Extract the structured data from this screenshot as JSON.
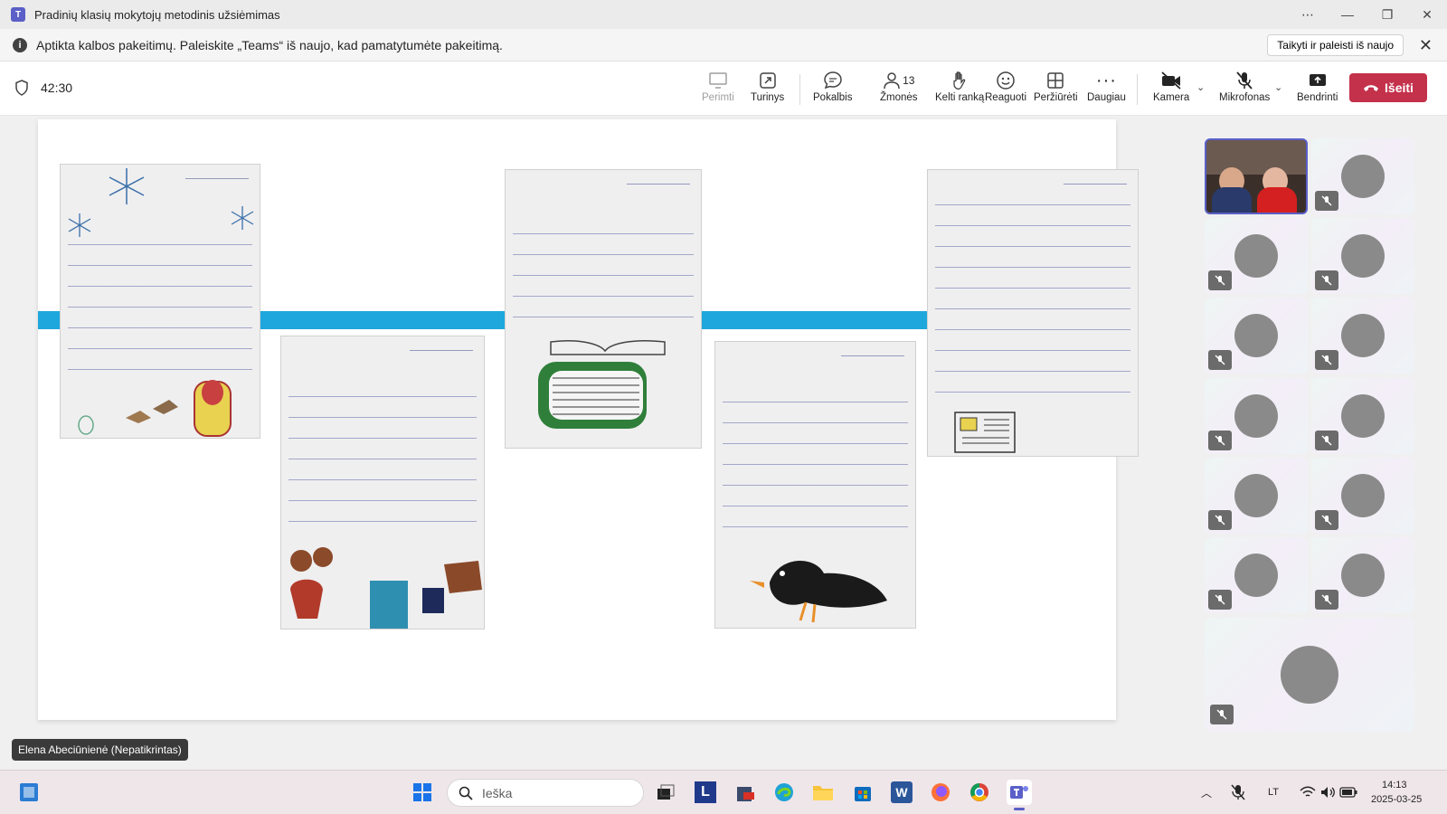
{
  "window": {
    "title": "Pradinių klasių mokytojų metodinis užsiėmimas",
    "app_icon_letter": "T"
  },
  "notice": {
    "message": "Aptikta kalbos pakeitimų. Paleiskite „Teams“ iš naujo, kad pamatytumėte pakeitimą.",
    "restart_label": "Taikyti ir paleisti iš naujo"
  },
  "meeting": {
    "timer": "42:30",
    "people_count": "13",
    "toolbar": {
      "takeover": "Perimti",
      "content": "Turinys",
      "chat": "Pokalbis",
      "people": "Žmonės",
      "raise_hand": "Kelti ranką",
      "react": "Reaguoti",
      "view": "Peržiūrėti",
      "more": "Daugiau",
      "camera": "Kamera",
      "mic": "Mikrofonas",
      "share": "Bendrinti",
      "leave": "Išeiti"
    },
    "presenter_label": "Elena Abeciūnienė (Nepatikrintas)"
  },
  "taskbar": {
    "search_placeholder": "Ieška",
    "language": "LT",
    "time": "14:13",
    "date": "2025-03-25"
  },
  "colors": {
    "accent": "#5b5fc7",
    "leave": "#c4314b",
    "slide_band": "#1ea7dd"
  }
}
